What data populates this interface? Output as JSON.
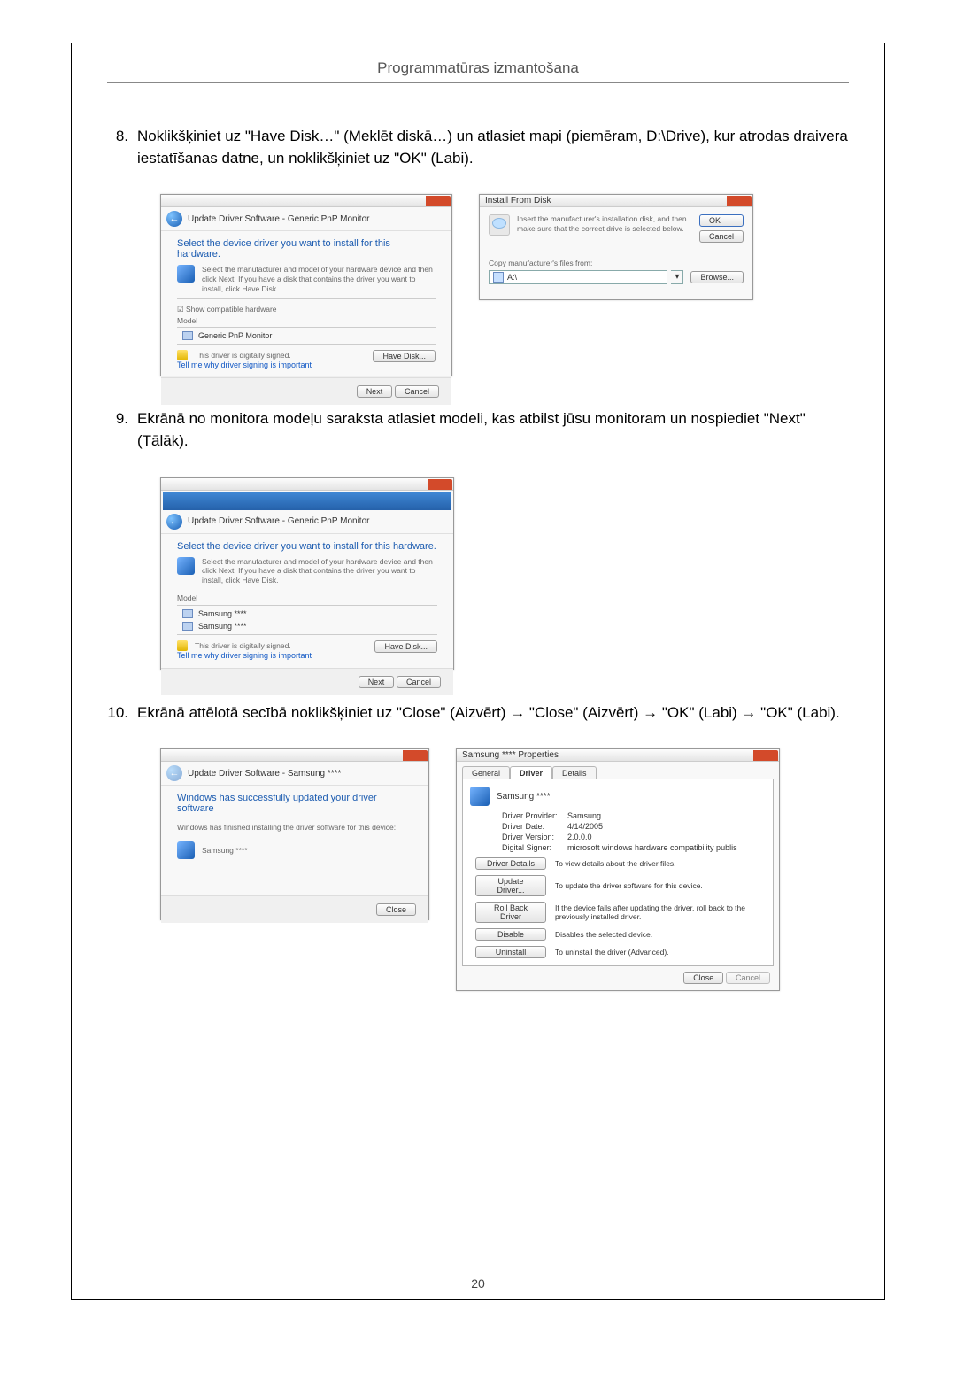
{
  "page": {
    "header": "Programmatūras izmantošana",
    "number": "20"
  },
  "steps": {
    "s8": {
      "num": "8.",
      "text": "Noklikšķiniet uz \"Have Disk…\" (Meklēt diskā…) un atlasiet mapi (piemēram, D:\\Drive), kur atrodas draivera iestatīšanas datne, un noklikšķiniet uz \"OK\" (Labi)."
    },
    "s9": {
      "num": "9.",
      "text": "Ekrānā no monitora modeļu saraksta atlasiet modeli, kas atbilst jūsu monitoram un nospiediet \"Next\" (Tālāk)."
    },
    "s10": {
      "num": "10.",
      "text": "Ekrānā attēlotā secībā noklikšķiniet uz \"Close\" (Aizvērt) → \"Close\" (Aizvērt) → \"OK\" (Labi) → \"OK\" (Labi)."
    }
  },
  "wizA": {
    "crumb": "Update Driver Software - Generic PnP Monitor",
    "heading": "Select the device driver you want to install for this hardware.",
    "hint": "Select the manufacturer and model of your hardware device and then click Next. If you have a disk that contains the driver you want to install, click Have Disk.",
    "checkbox": "Show compatible hardware",
    "col": "Model",
    "item": "Generic PnP Monitor",
    "signed": "This driver is digitally signed.",
    "tell": "Tell me why driver signing is important",
    "haveDisk": "Have Disk...",
    "next": "Next",
    "cancel": "Cancel"
  },
  "ifd": {
    "title": "Install From Disk",
    "msg": "Insert the manufacturer's installation disk, and then make sure that the correct drive is selected below.",
    "ok": "OK",
    "cancel": "Cancel",
    "copy": "Copy manufacturer's files from:",
    "value": "A:\\",
    "browse": "Browse..."
  },
  "wizB": {
    "crumb": "Update Driver Software - Generic PnP Monitor",
    "heading": "Select the device driver you want to install for this hardware.",
    "hint": "Select the manufacturer and model of your hardware device and then click Next. If you have a disk that contains the driver you want to install, click Have Disk.",
    "col": "Model",
    "item1": "Samsung ****",
    "item2": "Samsung ****",
    "signed": "This driver is digitally signed.",
    "tell": "Tell me why driver signing is important",
    "haveDisk": "Have Disk...",
    "next": "Next",
    "cancel": "Cancel"
  },
  "wizC": {
    "crumb": "Update Driver Software - Samsung ****",
    "heading": "Windows has successfully updated your driver software",
    "sub": "Windows has finished installing the driver software for this device:",
    "device": "Samsung ****",
    "close": "Close"
  },
  "props": {
    "title": "Samsung **** Properties",
    "tabs": {
      "general": "General",
      "driver": "Driver",
      "details": "Details"
    },
    "device": "Samsung ****",
    "kv": {
      "provider_k": "Driver Provider:",
      "provider_v": "Samsung",
      "date_k": "Driver Date:",
      "date_v": "4/14/2005",
      "version_k": "Driver Version:",
      "version_v": "2.0.0.0",
      "signer_k": "Digital Signer:",
      "signer_v": "microsoft windows hardware compatibility publis"
    },
    "btns": {
      "details": "Driver Details",
      "details_d": "To view details about the driver files.",
      "update": "Update Driver...",
      "update_d": "To update the driver software for this device.",
      "rollback": "Roll Back Driver",
      "rollback_d": "If the device fails after updating the driver, roll back to the previously installed driver.",
      "disable": "Disable",
      "disable_d": "Disables the selected device.",
      "uninstall": "Uninstall",
      "uninstall_d": "To uninstall the driver (Advanced)."
    },
    "close": "Close",
    "cancel": "Cancel"
  }
}
